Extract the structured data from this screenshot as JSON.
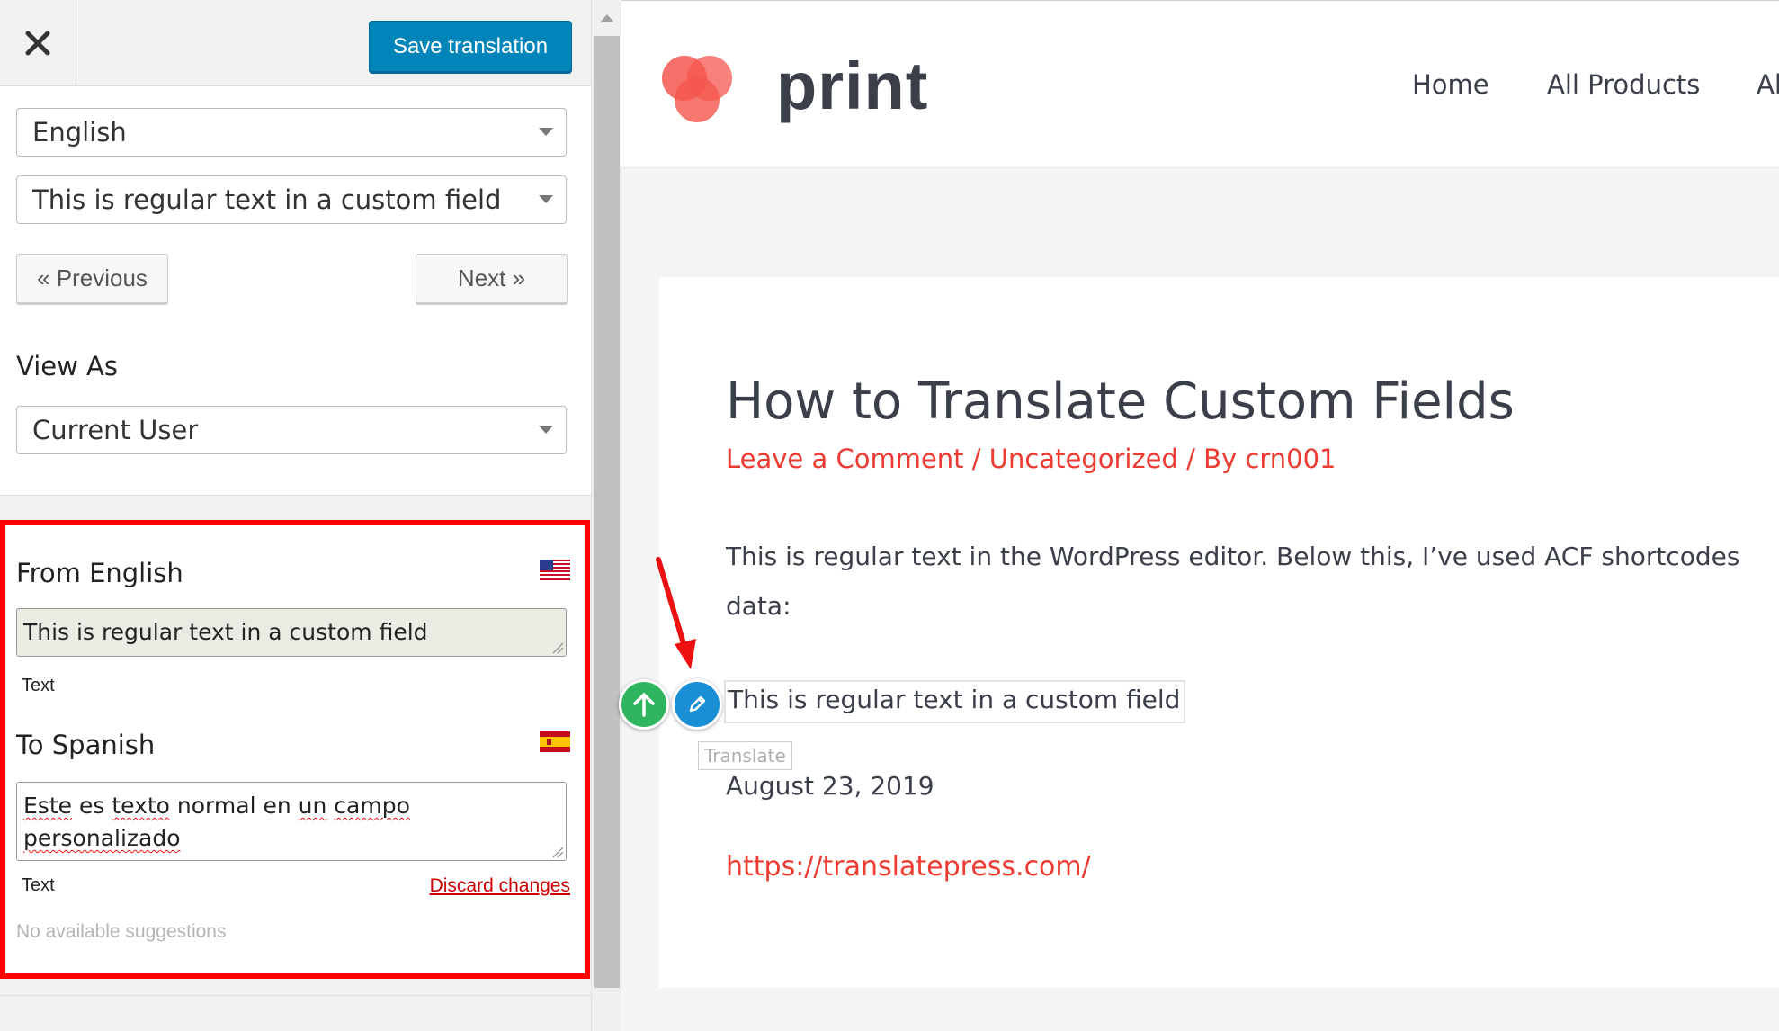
{
  "editor": {
    "save_label": "Save translation",
    "language_select": {
      "value": "English"
    },
    "string_select": {
      "value": "This is regular text in a custom field"
    },
    "previous_label": "« Previous",
    "next_label": "Next »",
    "view_as_label": "View As",
    "view_as_select": {
      "value": "Current User"
    },
    "from": {
      "label": "From English",
      "text": "This is regular text in a custom field",
      "type_label": "Text"
    },
    "to": {
      "label": "To Spanish",
      "text_words": [
        "Este",
        " es ",
        "texto",
        " normal en ",
        "un",
        " ",
        "campo",
        " ",
        "personalizado"
      ],
      "type_label": "Text",
      "discard_label": "Discard changes"
    },
    "suggestions_text": "No available suggestions"
  },
  "site": {
    "logo_text": "print",
    "nav": [
      "Home",
      "All Products",
      "Al"
    ],
    "post": {
      "title": "How to Translate Custom Fields",
      "meta": {
        "comment": "Leave a Comment",
        "sep1": " / ",
        "category": "Uncategorized",
        "sep2": " / By ",
        "author": "crn001"
      },
      "body_line1": "This is regular text in the WordPress editor. Below this, I’ve used ACF shortcodes",
      "body_line2": "data:",
      "custom_field_text": "This is regular text in a custom field",
      "tooltip": "Translate",
      "date": "August 23, 2019",
      "url": "https://translatepress.com/"
    }
  },
  "colors": {
    "primary_button": "#0085ba",
    "highlight_border": "#ff0000",
    "accent_red": "#ee3b32",
    "edit_icon_blue": "#1a8fd6",
    "merge_icon_green": "#2fb55d"
  },
  "icons": {
    "close": "close-icon",
    "edit": "pencil-icon",
    "merge": "arrow-up-icon",
    "flag_from": "us-flag-icon",
    "flag_to": "spain-flag-icon"
  }
}
